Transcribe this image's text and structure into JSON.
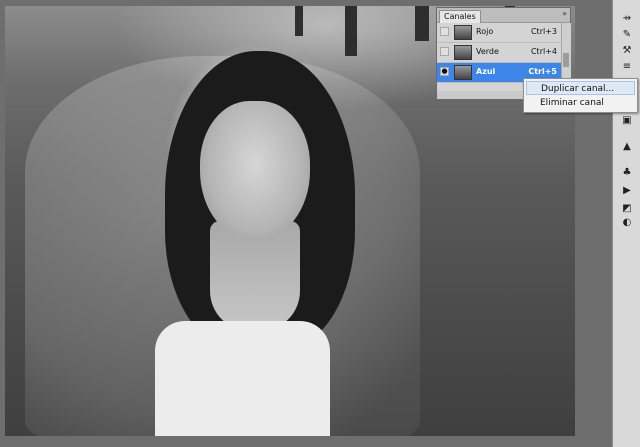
{
  "channels_panel": {
    "tab_label": "Canales",
    "collapse_icon": "double-chevron-right-icon",
    "channels": [
      {
        "name": "Rojo",
        "shortcut": "Ctrl+3",
        "selected": false,
        "visible": false
      },
      {
        "name": "Verde",
        "shortcut": "Ctrl+4",
        "selected": false,
        "visible": false
      },
      {
        "name": "Azul",
        "shortcut": "Ctrl+5",
        "selected": true,
        "visible": true
      }
    ]
  },
  "context_menu": {
    "items": [
      {
        "label": "Duplicar canal..."
      },
      {
        "label": "Eliminar canal"
      }
    ]
  },
  "colors": {
    "selection": "#3b86e8",
    "workspace": "#6e6e6e"
  }
}
